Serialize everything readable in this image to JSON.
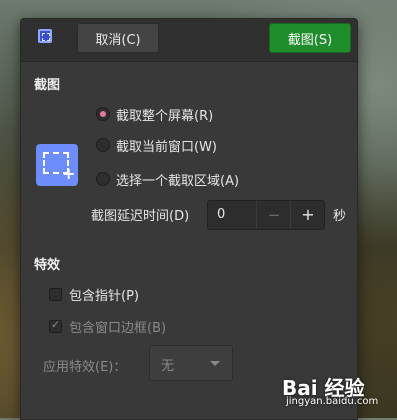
{
  "header": {
    "icon": "screenshot-app-icon",
    "cancel_label": "取消(C)",
    "take_label": "截图(S)",
    "take_color": "#1f8d2c"
  },
  "capture": {
    "title": "截图",
    "icon": "area-selection-icon",
    "options": [
      {
        "label": "截取整个屏幕(R)",
        "checked": true
      },
      {
        "label": "截取当前窗口(W)",
        "checked": false
      },
      {
        "label": "选择一个截取区域(A)",
        "checked": false
      }
    ],
    "delay_label": "截图延迟时间(D)",
    "delay_value": "0",
    "delay_minus": "−",
    "delay_plus": "+",
    "delay_unit": "秒"
  },
  "effects": {
    "title": "特效",
    "include_pointer_label": "包含指针(P)",
    "include_pointer_checked": false,
    "include_border_label": "包含窗口边框(B)",
    "include_border_checked": true,
    "apply_effect_label": "应用特效(E)：",
    "apply_effect_value": "无"
  },
  "watermark": {
    "logo": "Bai 经验",
    "url": "jingyan.baidu.com"
  }
}
